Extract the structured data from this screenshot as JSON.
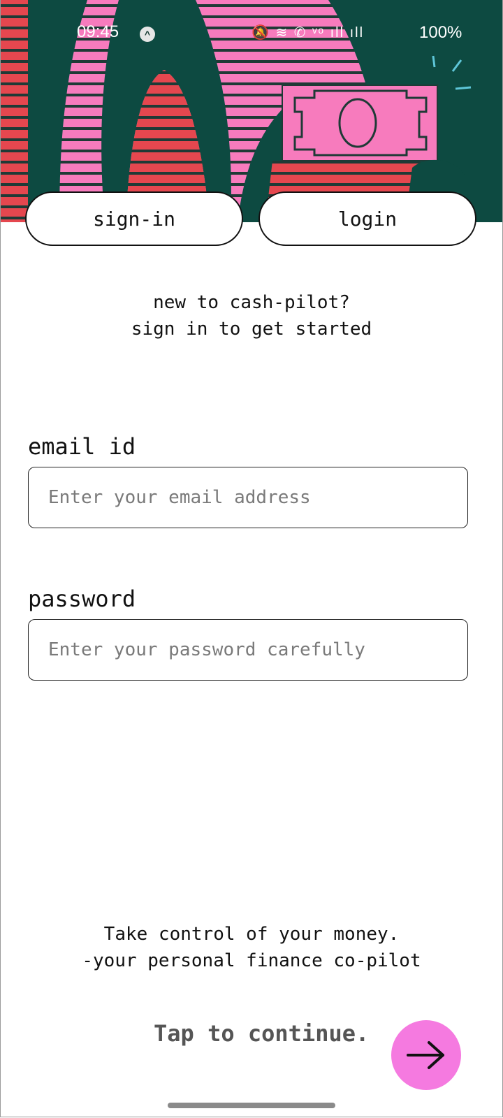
{
  "status_bar": {
    "time": "09:45",
    "alert_glyph": "^",
    "icons": [
      "mute-icon",
      "wifi-icon",
      "wifi-call-icon",
      "volte-icon",
      "signal-icon",
      "signal-icon"
    ],
    "icons_text": "🔕 ≋ ✆ ᵛᵒ ıll ıll",
    "battery": "100%"
  },
  "tabs": {
    "sign_in": "sign-in",
    "login": "login"
  },
  "intro": {
    "line1": "new to cash-pilot?",
    "line2": "sign in to get started"
  },
  "form": {
    "email_label": "email id",
    "email_placeholder": "Enter your email address",
    "email_value": "",
    "password_label": "password",
    "password_placeholder": "Enter your password carefully",
    "password_value": ""
  },
  "tagline": {
    "line1": "Take control of your money.",
    "line2": "-your personal finance co-pilot"
  },
  "footer": {
    "continue_label": "Tap to continue."
  },
  "colors": {
    "dark_green": "#0d4a41",
    "pink": "#f77bbd",
    "red": "#e5474f",
    "accent": "#f57ae0"
  }
}
